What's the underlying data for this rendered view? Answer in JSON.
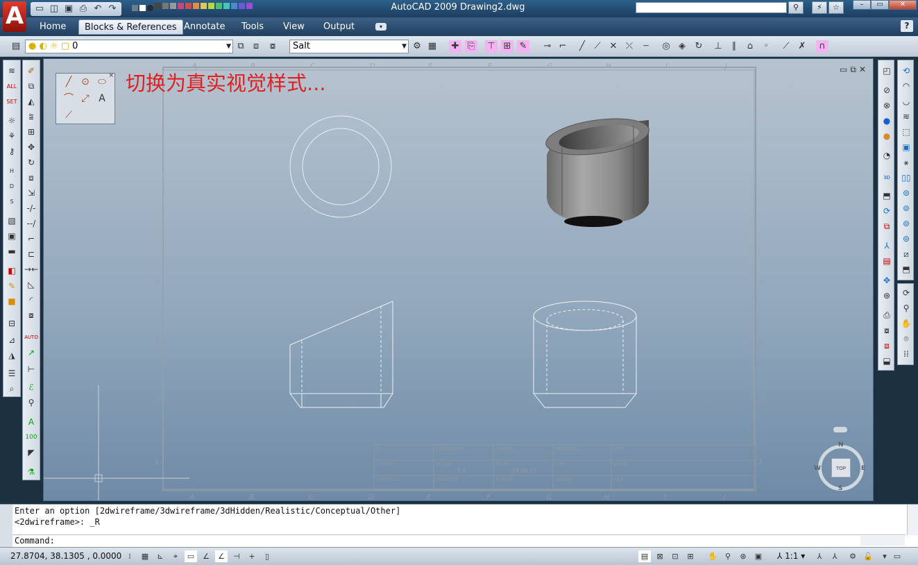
{
  "app": {
    "logo_letter": "A",
    "title": "AutoCAD 2009 Drawing2.dwg"
  },
  "colors": {
    "logo": "#c62a1c",
    "annotation": "#e02020",
    "viewport_top": "#b7c3cf",
    "viewport_bottom": "#6f8aa6",
    "highlight": "#f3b2f0"
  },
  "quick_access": [
    "new-icon",
    "open-icon",
    "save-icon",
    "print-icon",
    "undo-icon",
    "redo-icon"
  ],
  "ribbon": {
    "tabs": [
      {
        "label": "Home",
        "active": false
      },
      {
        "label": "Blocks & References",
        "active": true
      },
      {
        "label": "Annotate",
        "active": false
      },
      {
        "label": "Tools",
        "active": false
      },
      {
        "label": "View",
        "active": false
      },
      {
        "label": "Output",
        "active": false
      }
    ],
    "help_label": "?"
  },
  "toolbar": {
    "layer_value": "0",
    "style_value": "Salt"
  },
  "viewport": {
    "annotation": "切换为真实视觉样式...",
    "grid_letters": [
      "A",
      "B",
      "C",
      "D",
      "E",
      "F",
      "G",
      "H",
      "I",
      "J"
    ],
    "grid_numbers": [
      "1",
      "2",
      "3",
      "4"
    ],
    "title_block": {
      "r1": [
        "R4",
        "TOLERANCE",
        "FINISH",
        "MATERIAL",
        "SPEC"
      ],
      "r2": [
        "ANGULT",
        "SCALE",
        "DATE",
        "VER",
        "NAME"
      ],
      "r3": [
        "APPROVAL",
        "CHECKED",
        "DESIGN",
        "DRAWN",
        "FILE"
      ],
      "scale_value": "1:1",
      "date_value": "09.06.11"
    },
    "viewcube": {
      "top": "TOP",
      "n": "N",
      "s": "S",
      "e": "E",
      "w": "W"
    }
  },
  "command_line": {
    "line1": "Enter an option [2dwireframe/3dwireframe/3dHidden/Realistic/Conceptual/Other]",
    "line2": "<2dwireframe>: _R",
    "prompt": "Command:"
  },
  "status_bar": {
    "coordinates": "27.8704, 38.1305 , 0.0000",
    "annotation_scale": "1:1"
  }
}
